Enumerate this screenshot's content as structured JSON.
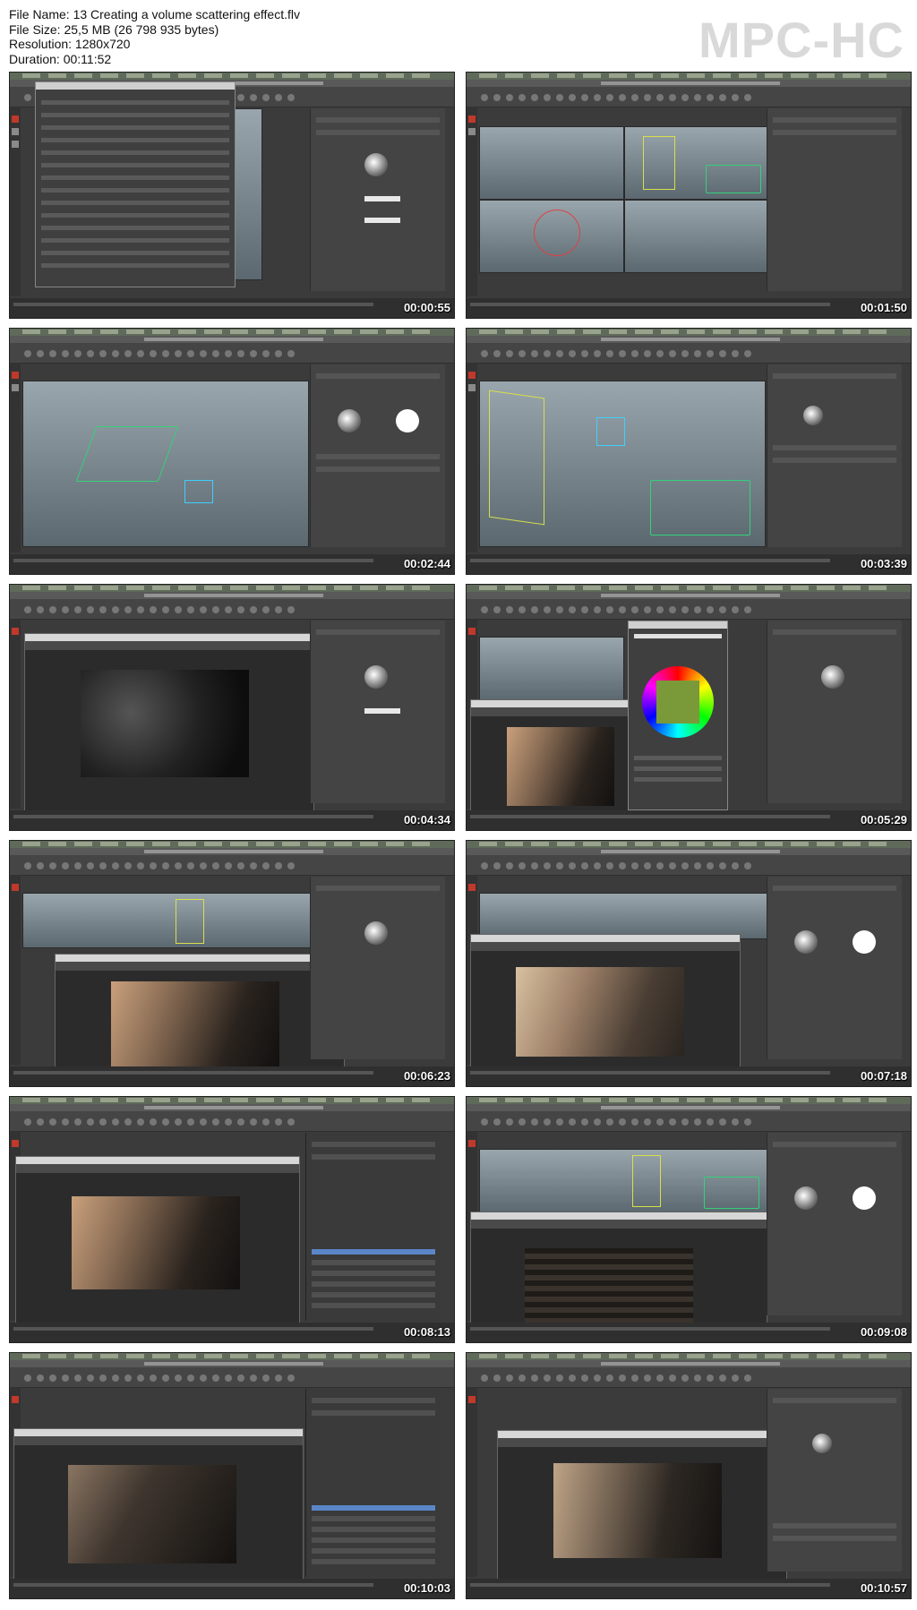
{
  "file_info": {
    "file_name": "File Name: 13 Creating a volume scattering effect.flv",
    "file_size": "File Size: 25,5 MB (26 798 935 bytes)",
    "resolution": "Resolution: 1280x720",
    "duration": "Duration: 00:11:52"
  },
  "logo": "MPC-HC",
  "frames": [
    {
      "timestamp": "00:00:55",
      "scene": "render-settings-dialog"
    },
    {
      "timestamp": "00:01:50",
      "scene": "four-viewports"
    },
    {
      "timestamp": "00:02:44",
      "scene": "spotlight-viewport"
    },
    {
      "timestamp": "00:03:39",
      "scene": "room-wireframe"
    },
    {
      "timestamp": "00:04:34",
      "scene": "render-view-dark"
    },
    {
      "timestamp": "00:05:29",
      "scene": "color-picker"
    },
    {
      "timestamp": "00:06:23",
      "scene": "render-view-warm"
    },
    {
      "timestamp": "00:07:18",
      "scene": "render-view-light"
    },
    {
      "timestamp": "00:08:13",
      "scene": "render-view-outliner"
    },
    {
      "timestamp": "00:09:08",
      "scene": "render-view-pixelated"
    },
    {
      "timestamp": "00:10:03",
      "scene": "render-view-outliner-dark"
    },
    {
      "timestamp": "00:10:57",
      "scene": "render-view-final"
    }
  ]
}
